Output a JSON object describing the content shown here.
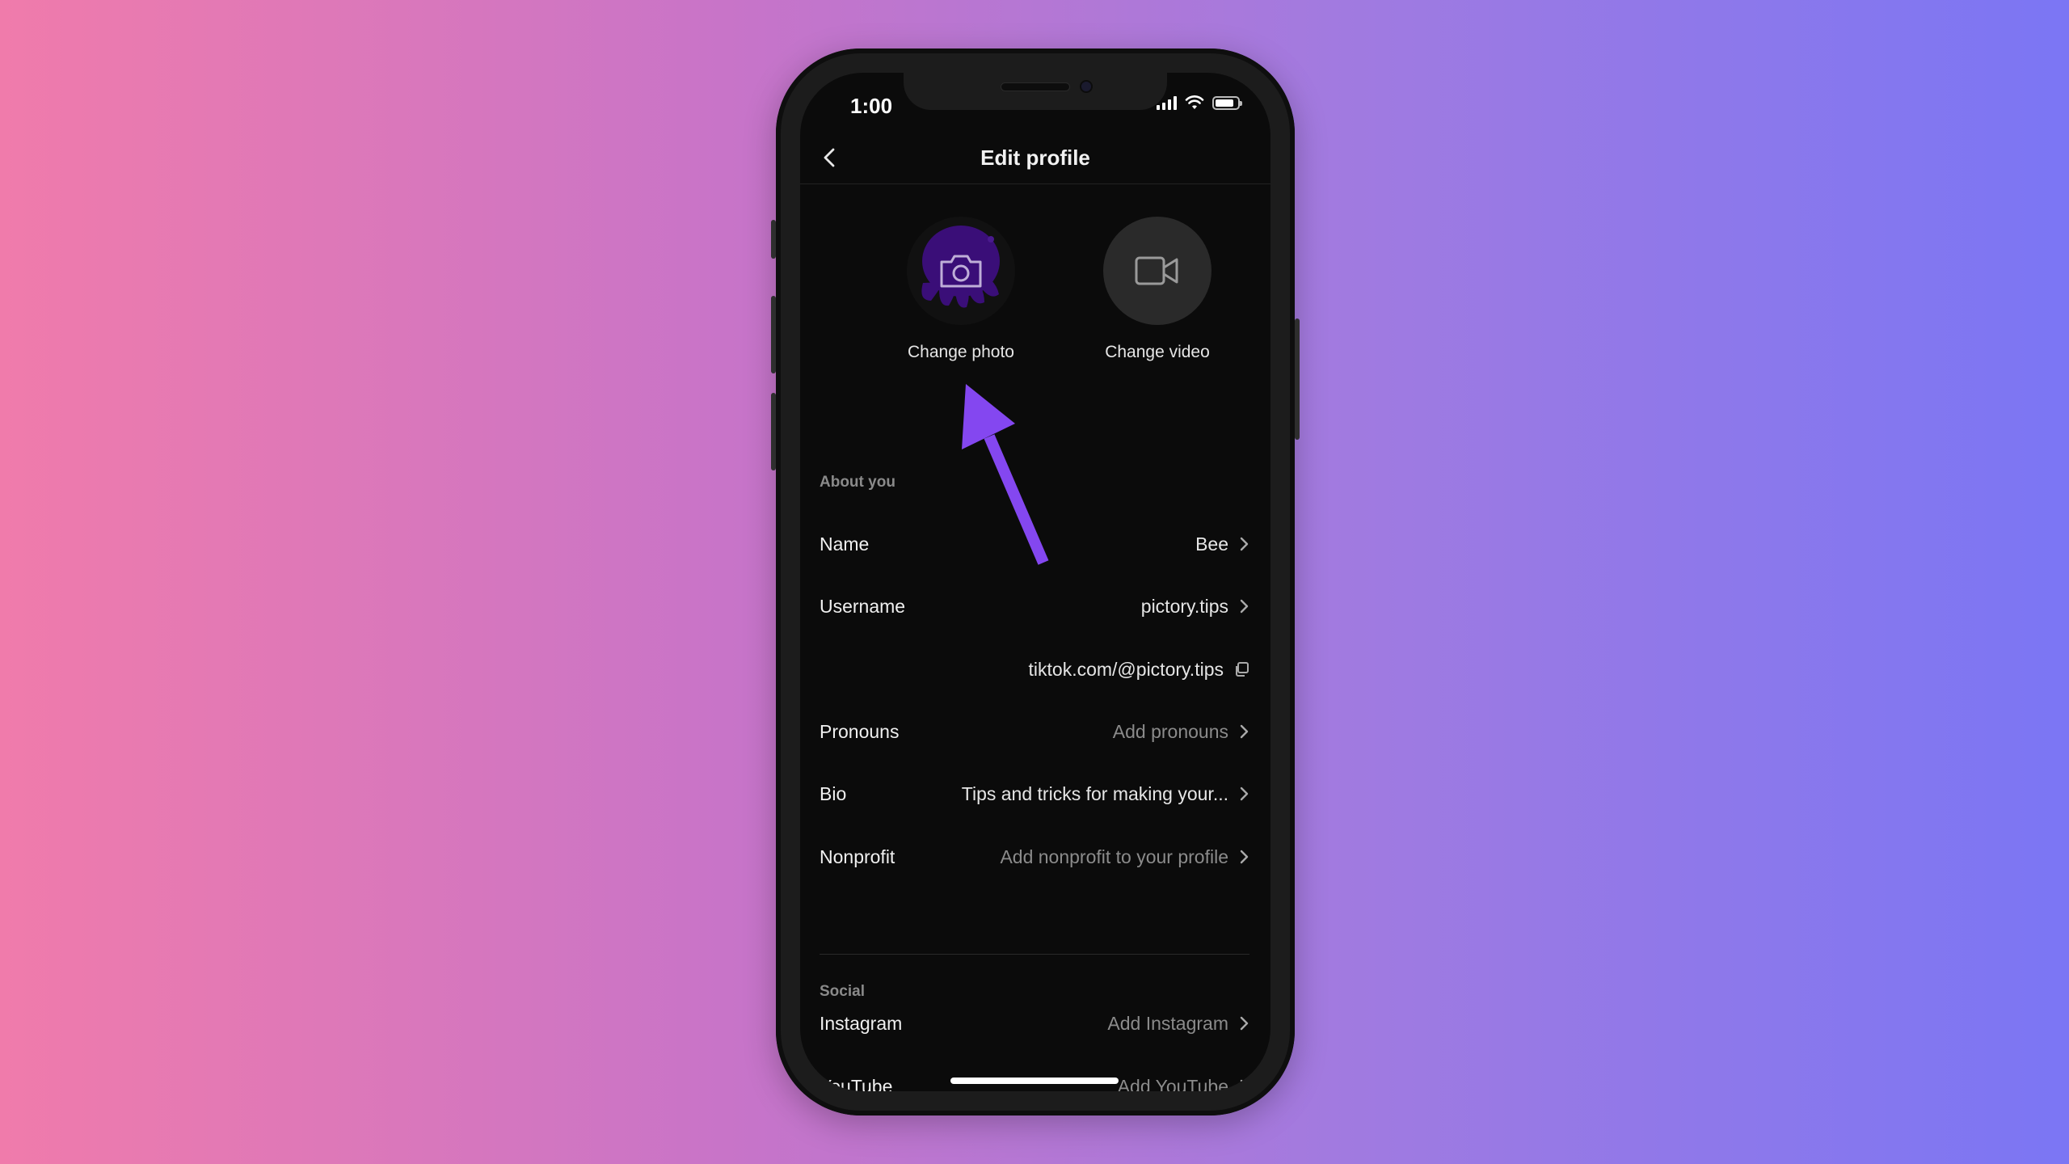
{
  "status_bar": {
    "time": "1:00",
    "battery_level": 0.85
  },
  "header": {
    "title": "Edit profile",
    "back_icon": "chevron-left-icon"
  },
  "media": {
    "photo": {
      "label": "Change photo",
      "icon": "camera-icon"
    },
    "video": {
      "label": "Change video",
      "icon": "video-camera-icon"
    }
  },
  "about": {
    "section_label": "About you",
    "rows": [
      {
        "label": "Name",
        "value": "Bee",
        "placeholder": false
      },
      {
        "label": "Username",
        "value": "pictory.tips",
        "placeholder": false
      },
      {
        "label": "",
        "value": "tiktok.com/@pictory.tips",
        "placeholder": false,
        "icon": "copy-icon"
      },
      {
        "label": "Pronouns",
        "value": "Add pronouns",
        "placeholder": true
      },
      {
        "label": "Bio",
        "value": "Tips and tricks for making your...",
        "placeholder": false
      },
      {
        "label": "Nonprofit",
        "value": "Add nonprofit to your profile",
        "placeholder": true
      }
    ]
  },
  "social": {
    "section_label": "Social",
    "rows": [
      {
        "label": "Instagram",
        "value": "Add Instagram",
        "placeholder": true
      },
      {
        "label": "YouTube",
        "value": "Add YouTube",
        "placeholder": true
      }
    ]
  },
  "annotation": {
    "type": "arrow",
    "color": "#8447f0",
    "points_to": "Change photo"
  },
  "colors": {
    "accent": "#8447f0",
    "avatar_purple": "#3a0e78",
    "screen_bg": "#0b0b0b"
  }
}
